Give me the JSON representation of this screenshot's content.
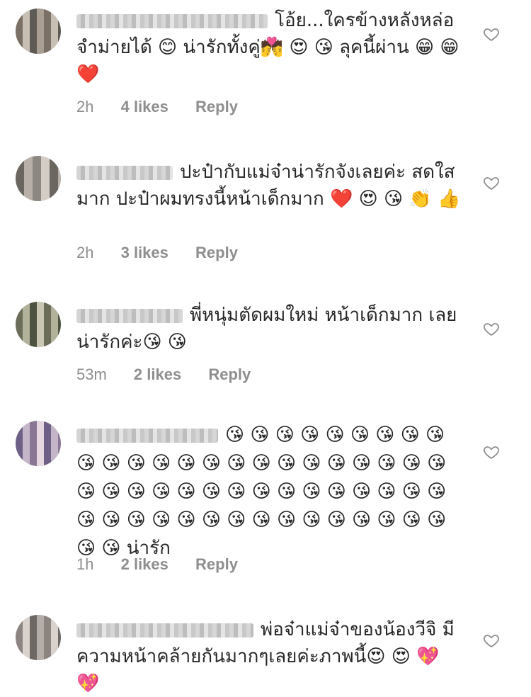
{
  "comments": [
    {
      "text": "โอ้ย...ใครข้างหลังหล่อจำม่ายได้ 😊 น่ารักทั้งคู่💏 😍 😘 ลุคนี้ผ่าน 😁 😁 ❤️",
      "time": "2h",
      "likes": "4 likes",
      "reply": "Reply"
    },
    {
      "text": "ปะป๋ากับแม่จ๋าน่ารักจังเลยค่ะ สดใสมาก ปะป๋าผมทรงนี้หน้าเด็กมาก ❤️ 😍 😘 👏 👍",
      "time": "2h",
      "likes": "3 likes",
      "reply": "Reply"
    },
    {
      "text": "พี่หนุ่มตัดผมใหม่ หน้าเด็กมาก เลย น่ารักค่ะ😘 😘",
      "time": "53m",
      "likes": "2 likes",
      "reply": "Reply"
    },
    {
      "text": "😘 😘 😘 😘 😘 😘 😘 😘 😘 😘 😘 😘 😘 😘 😘 😘 😘 😘 😘 😘 😘 😘 😘 😘 😘 😘 😘 😘 😘 😘 😘 😘 😘 😘 😘 😘 😘 😘 😘 😘 😘 😘 😘 😘 😘 😘 😘 😘 😘 😘 😘 😘 😘 😘 😘 😘 น่ารัก",
      "time": "1h",
      "likes": "2 likes",
      "reply": "Reply"
    },
    {
      "text": "พ่อจ๋าแม่จ๋าของน้องวีจิ มีความหน้าคล้ายกันมากๆเลยค่ะภาพนี้😍 😍 💖 💖"
    }
  ],
  "icons": {
    "like": "heart-outline-icon"
  },
  "colors": {
    "text": "#262626",
    "meta": "#8e8e8e",
    "icon": "#8e8e8e"
  }
}
